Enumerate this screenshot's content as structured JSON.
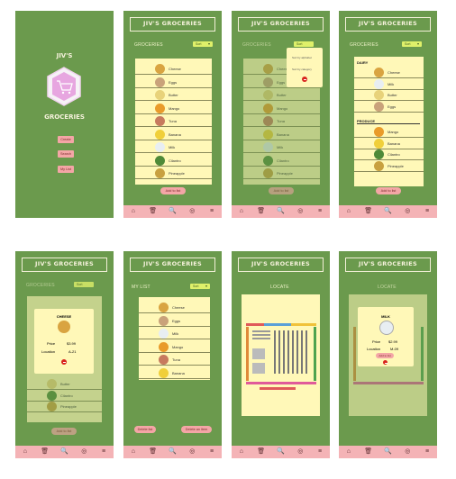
{
  "app": {
    "title": "JIV'S GROCERIES",
    "title_top": "JIV'S",
    "title_bottom": "GROCERIES"
  },
  "splash": {
    "buttons": [
      "Create",
      "Search",
      "My List"
    ]
  },
  "groceries": {
    "section": "GROCERIES",
    "sort_label": "Sort",
    "add_label": "Add to list",
    "items": [
      {
        "name": "Cheese",
        "color": "#d9a441"
      },
      {
        "name": "Eggs",
        "color": "#c9a27a"
      },
      {
        "name": "Butter",
        "color": "#e8d27a"
      },
      {
        "name": "Mango",
        "color": "#e99b2a"
      },
      {
        "name": "Tuna",
        "color": "#c77a5e"
      },
      {
        "name": "Banana",
        "color": "#f0cf3a"
      },
      {
        "name": "Milk",
        "color": "#e8eef2"
      },
      {
        "name": "Cilantro",
        "color": "#4f8a38"
      },
      {
        "name": "Pineapple",
        "color": "#c8a040"
      }
    ]
  },
  "sort_menu": {
    "by_alpha": "Sort by alphabet",
    "by_category": "Sort by category"
  },
  "categories": {
    "dairy_label": "DAIRY",
    "dairy": [
      {
        "name": "Cheese",
        "color": "#d9a441"
      },
      {
        "name": "Milk",
        "color": "#e8eef2"
      },
      {
        "name": "Butter",
        "color": "#e8d27a"
      },
      {
        "name": "Eggs",
        "color": "#c9a27a"
      }
    ],
    "produce_label": "PRODUCE",
    "produce": [
      {
        "name": "Mango",
        "color": "#e99b2a"
      },
      {
        "name": "Banana",
        "color": "#f0cf3a"
      },
      {
        "name": "Cilantro",
        "color": "#4f8a38"
      },
      {
        "name": "Pineapple",
        "color": "#c8a040"
      }
    ]
  },
  "detail_cheese": {
    "title": "CHEESE",
    "price_label": "Price",
    "price": "$3.99",
    "loc_label": "Location",
    "loc": "A-21",
    "bg_items": [
      {
        "name": "Butter",
        "color": "#e8d27a"
      },
      {
        "name": "Cilantro",
        "color": "#4f8a38"
      },
      {
        "name": "Pineapple",
        "color": "#c8a040"
      }
    ]
  },
  "mylist": {
    "title": "MY LIST",
    "items": [
      {
        "name": "Cheese",
        "color": "#d9a441"
      },
      {
        "name": "Eggs",
        "color": "#c9a27a"
      },
      {
        "name": "Milk",
        "color": "#e8eef2"
      },
      {
        "name": "Mango",
        "color": "#e99b2a"
      },
      {
        "name": "Tuna",
        "color": "#c77a5e"
      },
      {
        "name": "Banana",
        "color": "#f0cf3a"
      }
    ],
    "delete_list": "Delete list",
    "delete_item": "Delete an item"
  },
  "locate": {
    "title": "LOCATE"
  },
  "detail_milk": {
    "title": "MILK",
    "price_label": "Price",
    "price": "$2.99",
    "loc_label": "Location",
    "loc": "M-09",
    "add": "Add to list"
  },
  "tabs": [
    "⌂",
    "🗑",
    "🔍",
    "◎",
    "≡"
  ]
}
